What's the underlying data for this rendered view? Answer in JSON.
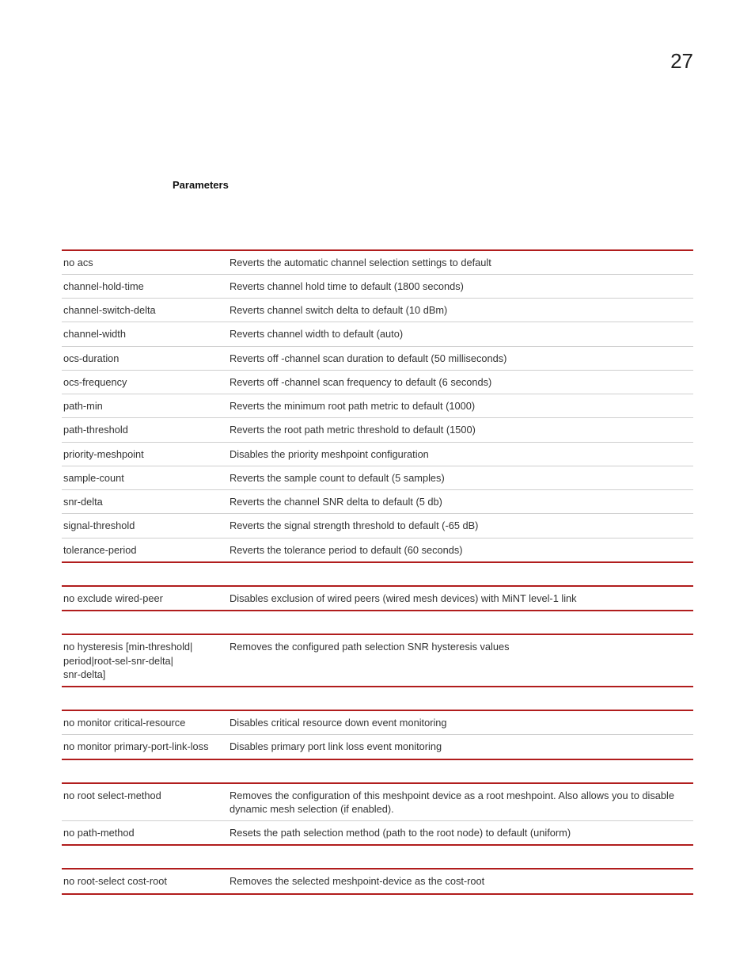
{
  "page_number": "27",
  "heading": "Parameters",
  "groups": [
    {
      "rows": [
        {
          "param": "no acs",
          "desc": "Reverts the automatic channel selection settings to default"
        },
        {
          "param": "channel-hold-time",
          "desc": "Reverts channel hold time to default (1800 seconds)"
        },
        {
          "param": "channel-switch-delta",
          "desc": "Reverts channel switch delta to default (10 dBm)"
        },
        {
          "param": "channel-width",
          "desc": "Reverts channel width to default (auto)"
        },
        {
          "param": "ocs-duration",
          "desc": "Reverts off -channel scan duration to default (50 milliseconds)"
        },
        {
          "param": "ocs-frequency",
          "desc": "Reverts off -channel scan frequency to default (6 seconds)"
        },
        {
          "param": "path-min",
          "desc": "Reverts the minimum root path metric to default (1000)"
        },
        {
          "param": "path-threshold",
          "desc": "Reverts the root path metric threshold to default (1500)"
        },
        {
          "param": "priority-meshpoint",
          "desc": "Disables the priority meshpoint configuration"
        },
        {
          "param": "sample-count",
          "desc": "Reverts the sample count to default (5 samples)"
        },
        {
          "param": "snr-delta",
          "desc": "Reverts the channel SNR delta to default (5 db)"
        },
        {
          "param": "signal-threshold",
          "desc": "Reverts the signal strength threshold to default (-65 dB)"
        },
        {
          "param": "tolerance-period",
          "desc": "Reverts the tolerance period to default (60 seconds)"
        }
      ]
    },
    {
      "rows": [
        {
          "param": "no exclude wired-peer",
          "desc": "Disables exclusion of wired peers (wired mesh devices) with MiNT level-1 link"
        }
      ]
    },
    {
      "rows": [
        {
          "param": "no hysteresis [min-threshold|\nperiod|root-sel-snr-delta|\nsnr-delta]",
          "desc": "Removes the configured path selection SNR hysteresis values"
        }
      ]
    },
    {
      "rows": [
        {
          "param": "no monitor critical-resource",
          "desc": "Disables critical resource down event monitoring"
        },
        {
          "param": "no monitor primary-port-link-loss",
          "desc": "Disables primary port link loss event monitoring"
        }
      ]
    },
    {
      "rows": [
        {
          "param": "no root select-method",
          "desc": "Removes the configuration of this meshpoint device as a root meshpoint. Also allows you to disable dynamic mesh selection (if enabled)."
        },
        {
          "param": "no path-method",
          "desc": "Resets the path selection method (path to the root node) to default (uniform)"
        }
      ]
    },
    {
      "rows": [
        {
          "param": "no root-select cost-root",
          "desc": "Removes the selected meshpoint-device as the cost-root"
        }
      ]
    }
  ]
}
